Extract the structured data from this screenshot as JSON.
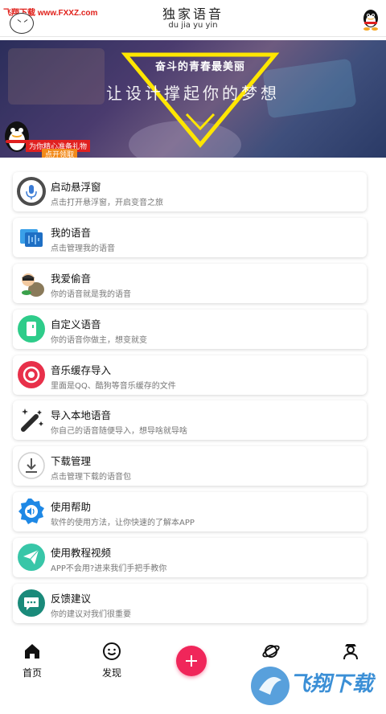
{
  "header": {
    "watermark": "飞翔下载 www.FXXZ.com",
    "title": "独家语音",
    "subtitle": "du jia yu yin"
  },
  "banner": {
    "triangle_text": "奋斗的青春最美丽",
    "headline": "让设计撑起你的梦想",
    "promo_line1": "为你精心准备礼物",
    "promo_line2": "点开领取"
  },
  "menu": [
    {
      "title": "启动悬浮窗",
      "subtitle": "点击打开悬浮窗，开启变音之旅",
      "icon": "microphone-icon"
    },
    {
      "title": "我的语音",
      "subtitle": "点击管理我的语音",
      "icon": "my-voice-icon"
    },
    {
      "title": "我爱偷音",
      "subtitle": "你的语音就是我的语音",
      "icon": "thief-icon"
    },
    {
      "title": "自定义语音",
      "subtitle": "你的语音你做主，想变就变",
      "icon": "custom-voice-icon"
    },
    {
      "title": "音乐缓存导入",
      "subtitle": "里面是QQ、酷狗等音乐缓存的文件",
      "icon": "music-record-icon"
    },
    {
      "title": "导入本地语音",
      "subtitle": "你自己的语音随便导入，想导啥就导啥",
      "icon": "magic-wand-icon"
    },
    {
      "title": "下载管理",
      "subtitle": "点击管理下载的语音包",
      "icon": "download-icon"
    },
    {
      "title": "使用帮助",
      "subtitle": "软件的使用方法，让你快速的了解本APP",
      "icon": "speaker-help-icon"
    },
    {
      "title": "使用教程视频",
      "subtitle": "APP不会用?进来我们手把手教你",
      "icon": "paper-plane-icon"
    },
    {
      "title": "反馈建议",
      "subtitle": "你的建议对我们很重要",
      "icon": "chat-bubble-icon"
    }
  ],
  "nav": {
    "home": "首页",
    "discover": "发现",
    "planet": "",
    "profile": ""
  },
  "watermark_logo": "飞翔下载",
  "colors": {
    "accent": "#f0265a",
    "mic": "#3a7bd5",
    "green": "#2ecc8a",
    "red": "#e8304a",
    "blue": "#1e88e5",
    "teal": "#1a8a7a"
  }
}
